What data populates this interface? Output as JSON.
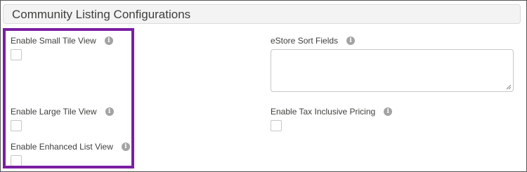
{
  "section": {
    "title": "Community Listing Configurations"
  },
  "fields": {
    "small_tile": {
      "label": "Enable Small Tile View",
      "checked": false
    },
    "large_tile": {
      "label": "Enable Large Tile View",
      "checked": false
    },
    "enhanced_list": {
      "label": "Enable Enhanced List View",
      "checked": false
    },
    "estore_sort": {
      "label": "eStore Sort Fields",
      "value": ""
    },
    "tax_inclusive": {
      "label": "Enable Tax Inclusive Pricing",
      "checked": false
    }
  },
  "icons": {
    "info": "info-icon",
    "info_glyph": "i"
  },
  "colors": {
    "highlight": "#7a1fa2",
    "header_bg": "#f3f3f3",
    "info_icon": "#a3a3a3"
  }
}
